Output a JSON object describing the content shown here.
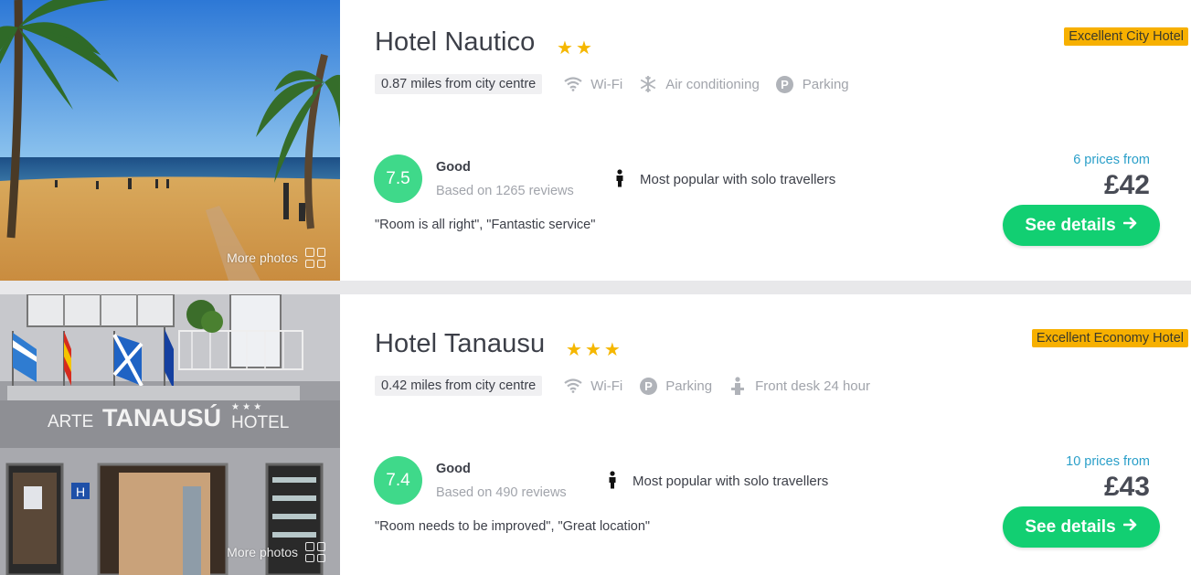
{
  "hotels": [
    {
      "name": "Hotel Nautico",
      "star_count": 2,
      "badge": "Excellent City Hotel",
      "distance": "0.87 miles from city centre",
      "amenities": [
        {
          "icon": "wifi-icon",
          "label": "Wi-Fi"
        },
        {
          "icon": "snowflake-icon",
          "label": "Air conditioning"
        },
        {
          "icon": "parking-icon",
          "label": "Parking"
        }
      ],
      "score": "7.5",
      "rating_label": "Good",
      "reviews": "Based on 1265 reviews",
      "popular": "Most popular with solo travellers",
      "quote": "\"Room is all right\", \"Fantastic service\"",
      "prices_from": "6 prices from",
      "price": "£42",
      "cta": "See details",
      "more_photos": "More photos"
    },
    {
      "name": "Hotel Tanausu",
      "star_count": 3,
      "badge": "Excellent Economy Hotel",
      "distance": "0.42 miles from city centre",
      "amenities": [
        {
          "icon": "wifi-icon",
          "label": "Wi-Fi"
        },
        {
          "icon": "parking-icon",
          "label": "Parking"
        },
        {
          "icon": "front-desk-icon",
          "label": "Front desk 24 hour"
        }
      ],
      "score": "7.4",
      "rating_label": "Good",
      "reviews": "Based on 490 reviews",
      "popular": "Most popular with solo travellers",
      "quote": "\"Room needs to be improved\", \"Great location\"",
      "prices_from": "10 prices from",
      "price": "£43",
      "cta": "See details",
      "more_photos": "More photos"
    }
  ],
  "photo_signage": {
    "left": "ARTE",
    "center": "TANAUSÚ",
    "right": "HOTEL",
    "stars": "★ ★ ★"
  },
  "colors": {
    "score_green": "#3fd98a",
    "cta_green": "#12cf72",
    "badge_yellow": "#f7b000",
    "star_yellow": "#f5b700",
    "prices_from_blue": "#2a9fc9"
  }
}
